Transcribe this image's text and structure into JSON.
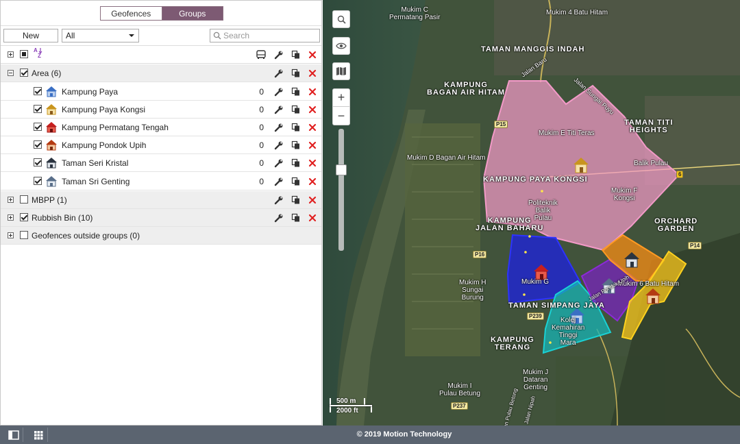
{
  "tabs": {
    "geofences": "Geofences",
    "groups": "Groups"
  },
  "toolbar": {
    "new_label": "New",
    "filter_value": "All",
    "search_placeholder": "Search"
  },
  "groups": [
    {
      "label": "Area (6)",
      "checked": true,
      "expanded": true
    },
    {
      "label": "MBPP (1)",
      "checked": false,
      "expanded": false
    },
    {
      "label": "Rubbish Bin (10)",
      "checked": true,
      "expanded": false
    },
    {
      "label": "Geofences outside groups (0)",
      "checked": false,
      "expanded": false
    }
  ],
  "areas": [
    {
      "name": "Kampung Paya",
      "count": "0",
      "icon": "house-blue-icon"
    },
    {
      "name": "Kampung Paya Kongsi",
      "count": "0",
      "icon": "house-yellow-icon"
    },
    {
      "name": "Kampung Permatang Tengah",
      "count": "0",
      "icon": "house-red-icon"
    },
    {
      "name": "Kampung Pondok Upih",
      "count": "0",
      "icon": "house-orange-icon"
    },
    {
      "name": "Taman Seri Kristal",
      "count": "0",
      "icon": "house-dark-icon"
    },
    {
      "name": "Taman Sri Genting",
      "count": "0",
      "icon": "house-grey-icon"
    }
  ],
  "map": {
    "labels": {
      "mukim_c": "Mukim C\nPermatang Pasir",
      "mukim4": "Mukim 4 Batu Hitam",
      "manggis": "TAMAN MANGGIS INDAH",
      "bagan": "KAMPUNG\nBAGAN AIR HITAM",
      "jalan_baru": "Jalan Baru",
      "jalan_ss": "Jalan Sungai Puyu",
      "titi_heights": "TAMAN TITI\nHEIGHTS",
      "mukim_e": "Mukim E Titi Teras",
      "mukim_d": "Mukim D Bagan Air Hitam",
      "balik": "Balik Pulau",
      "paya_kongsi": "KAMPUNG PAYA KONGSI",
      "mukim_f": "Mukim F\nKongsi",
      "politeknik": "Politeknik\nBalik\nPulau",
      "jalan_baharu": "KAMPUNG\nJALAN BAHARU",
      "orchard": "ORCHARD\nGARDEN",
      "mukim_g": "Mukim G",
      "mukim6": "Mukim 6 Batu Hitam",
      "mukim_h": "Mukim H\nSungai\nBurung",
      "simpang": "TAMAN SIMPANG JAYA",
      "kolej": "Kolej\nKemahiran\nTinggi\nMara",
      "terang": "KAMPUNG\nTERANG",
      "mukim_j": "Mukim J\nDataran\nGenting",
      "mukim_i": "Mukim I\nPulau Betung",
      "jalan_pondok": "Jalan Pondok Upih",
      "jalan_nipah": "Jalan Nipah",
      "pulau_betong": "Jalan Pulau Betong"
    },
    "roads": {
      "p15": "P15",
      "p16": "P16",
      "p239": "P239",
      "p237": "P237",
      "p14": "P14",
      "r6": "6"
    },
    "scale": {
      "metric": "500 m",
      "imperial": "2000 ft"
    }
  },
  "footer": {
    "copyright": "© 2019 Motion Technology"
  },
  "colors": {
    "accent": "#7d5a73",
    "delete": "#e02020",
    "footer": "#5b6470"
  }
}
